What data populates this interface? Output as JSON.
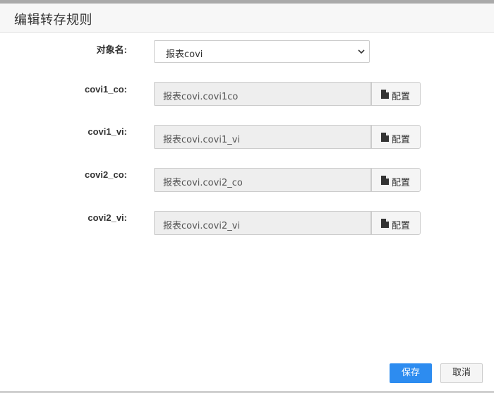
{
  "dialog": {
    "title": "编辑转存规则"
  },
  "object_name": {
    "label": "对象名:",
    "selected": "报表covi"
  },
  "fields": [
    {
      "label": "covi1_co:",
      "value": "报表covi.covi1co",
      "button": "配置",
      "icon": "file-icon"
    },
    {
      "label": "covi1_vi:",
      "value": "报表covi.covi1_vi",
      "button": "配置",
      "icon": "file-icon"
    },
    {
      "label": "covi2_co:",
      "value": "报表covi.covi2_co",
      "button": "配置",
      "icon": "file-icon"
    },
    {
      "label": "covi2_vi:",
      "value": "报表covi.covi2_vi",
      "button": "配置",
      "icon": "file-icon"
    }
  ],
  "footer": {
    "save_label": "保存",
    "cancel_label": "取消"
  },
  "colors": {
    "primary": "#2d8cf0",
    "readonly_bg": "#eeeeee",
    "header_bg": "#f7f7f7"
  }
}
